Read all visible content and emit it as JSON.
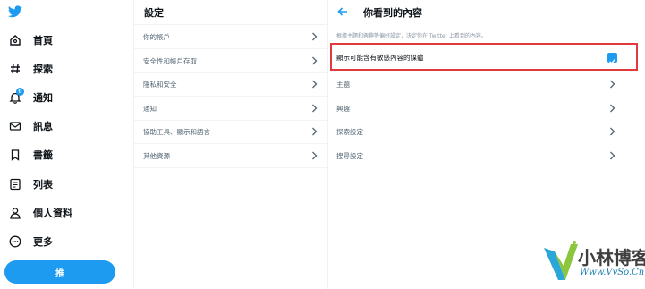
{
  "nav": {
    "items": [
      {
        "label": "首頁",
        "icon": "home-icon"
      },
      {
        "label": "探索",
        "icon": "hashtag-icon"
      },
      {
        "label": "通知",
        "icon": "bell-icon",
        "badge": "6"
      },
      {
        "label": "訊息",
        "icon": "envelope-icon"
      },
      {
        "label": "書籤",
        "icon": "bookmark-icon"
      },
      {
        "label": "列表",
        "icon": "list-icon"
      },
      {
        "label": "個人資料",
        "icon": "person-icon"
      },
      {
        "label": "更多",
        "icon": "more-icon"
      }
    ],
    "tweet_button": "推"
  },
  "settings": {
    "title": "設定",
    "items": [
      {
        "label": "你的帳戶"
      },
      {
        "label": "安全性和帳戶存取"
      },
      {
        "label": "隱私和安全"
      },
      {
        "label": "通知"
      },
      {
        "label": "協助工具、顯示和語言"
      },
      {
        "label": "其他資源"
      }
    ]
  },
  "content": {
    "title": "你看到的內容",
    "description": "根據主題和興趣等偏好設定，決定你在 Twitter 上看到的內容。",
    "media_option": {
      "label": "顯示可能含有敏感內容的媒體",
      "checked": true
    },
    "items": [
      {
        "label": "主題"
      },
      {
        "label": "興趣"
      },
      {
        "label": "探索設定"
      },
      {
        "label": "搜尋設定"
      }
    ]
  },
  "watermark": {
    "name": "小林博客",
    "url": "Www.VvSo.Cn"
  },
  "colors": {
    "accent": "#1d9bf0",
    "highlight": "#e0393e",
    "text": "#0f1419",
    "secondary": "#536471"
  }
}
